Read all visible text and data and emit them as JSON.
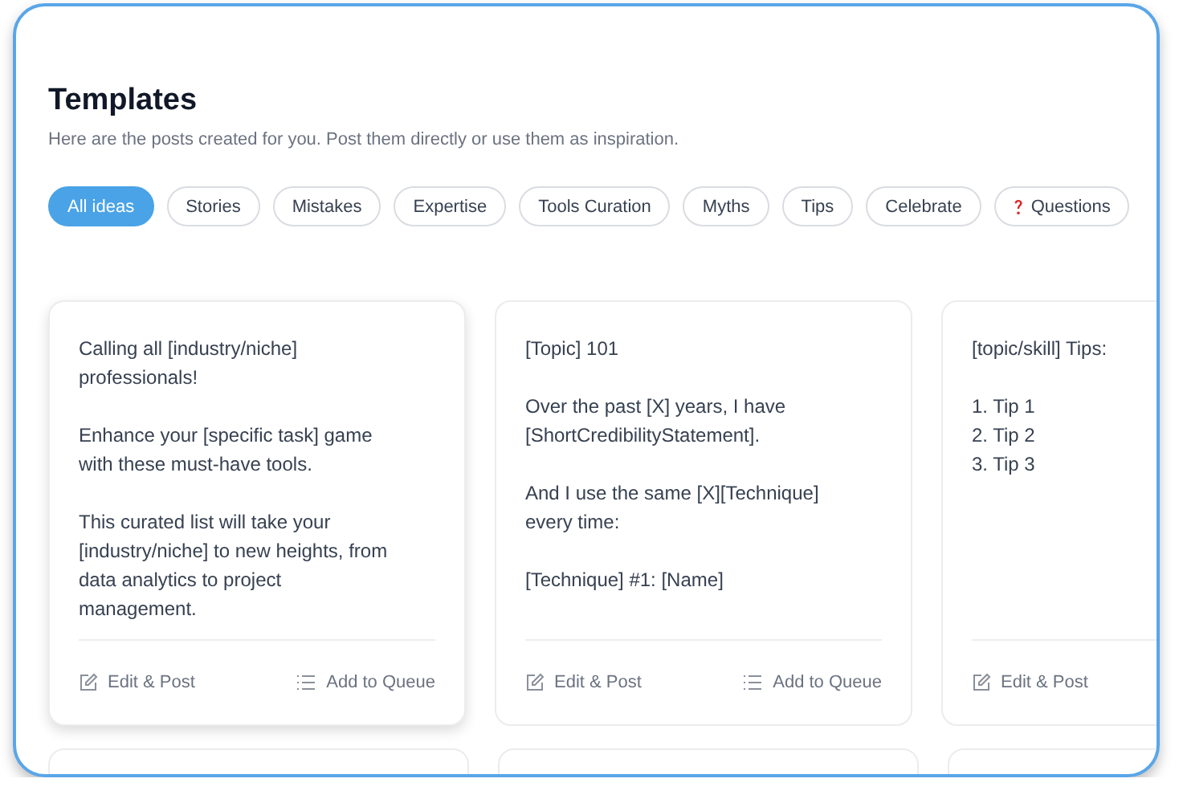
{
  "header": {
    "title": "Templates",
    "subtitle": "Here are the posts created for you. Post them directly or use them as inspiration."
  },
  "filters": [
    {
      "label": "All ideas",
      "selected": true
    },
    {
      "label": "Stories",
      "selected": false
    },
    {
      "label": "Mistakes",
      "selected": false
    },
    {
      "label": "Expertise",
      "selected": false
    },
    {
      "label": "Tools Curation",
      "selected": false
    },
    {
      "label": "Myths",
      "selected": false
    },
    {
      "label": "Tips",
      "selected": false
    },
    {
      "label": "Celebrate",
      "selected": false
    },
    {
      "label": "Questions",
      "selected": false,
      "kind": "question"
    }
  ],
  "cards": [
    {
      "highlighted": true,
      "paragraphs": [
        "Calling all [industry/niche] professionals!",
        "Enhance your [specific task] game with these must-have tools.",
        "This curated list will take your [industry/niche] to new heights, from data analytics to project management."
      ],
      "actions": [
        {
          "kind": "edit",
          "label": "Edit & Post"
        },
        {
          "kind": "queue",
          "label": "Add to Queue"
        }
      ]
    },
    {
      "highlighted": false,
      "paragraphs": [
        "[Topic] 101",
        "Over the past [X] years, I have [ShortCredibilityStatement].",
        "And I use the same [X][Technique] every time:",
        "[Technique] #1: [Name]"
      ],
      "actions": [
        {
          "kind": "edit",
          "label": "Edit & Post"
        },
        {
          "kind": "queue",
          "label": "Add to Queue"
        }
      ]
    },
    {
      "highlighted": false,
      "paragraphs": [
        "[topic/skill] Tips:",
        "1. Tip 1\n2. Tip 2\n3. Tip 3"
      ],
      "actions": [
        {
          "kind": "edit",
          "label": "Edit & Post"
        }
      ]
    }
  ]
}
